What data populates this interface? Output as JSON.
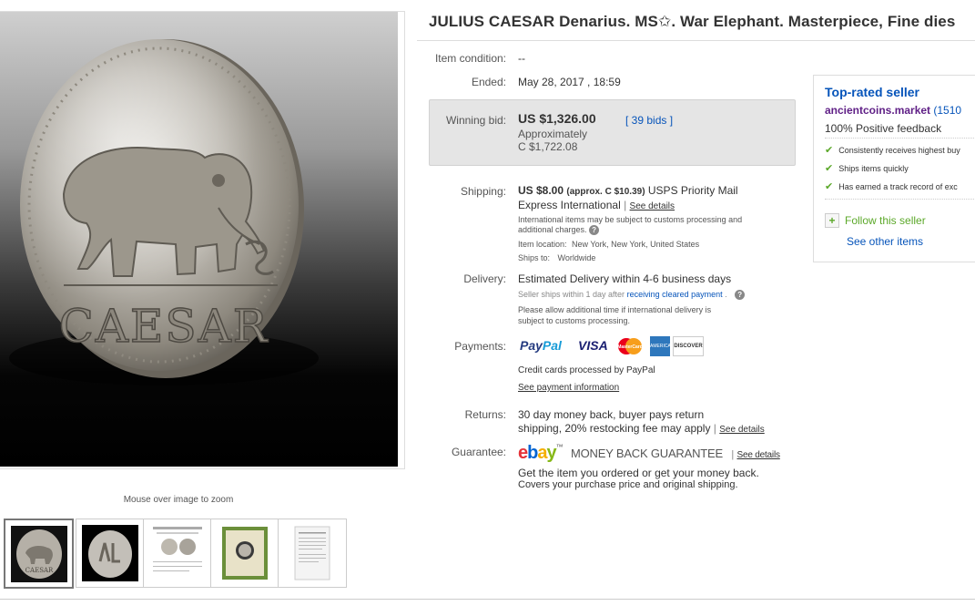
{
  "listing": {
    "title": "JULIUS CAESAR Denarius. MS✩. War Elephant. Masterpiece, Fine dies",
    "zoom_hint": "Mouse over image to zoom",
    "coin_inscription": "CAESAR"
  },
  "details": {
    "condition_label": "Item condition:",
    "condition_value": "--",
    "ended_label": "Ended:",
    "ended_value": "May 28, 2017 , 18:59",
    "bid_label": "Winning bid:",
    "bid_value": "US $1,326.00",
    "bids_link": "[ 39 bids ]",
    "approx_label": "Approximately",
    "approx_value": "C $1,722.08",
    "shipping_label": "Shipping:",
    "shipping_price": "US $8.00",
    "shipping_approx": "(approx. C $10.39)",
    "shipping_method_line1": "USPS Priority Mail",
    "shipping_method_line2": "Express International",
    "see_details": "See details",
    "customs_line1": "International items may be subject to customs processing and",
    "customs_line2": "additional charges.",
    "item_location_label": "Item location:",
    "item_location": "New York, New York, United States",
    "ships_to_label": "Ships to:",
    "ships_to": "Worldwide",
    "delivery_label": "Delivery:",
    "delivery_value": "Estimated Delivery within 4-6 business days",
    "seller_ships_pre": "Seller ships within 1 day after",
    "seller_ships_link": "receiving cleared payment",
    "seller_ships_post": ".",
    "delivery_note_line1": "Please allow additional time if international delivery is",
    "delivery_note_line2": "subject to customs processing.",
    "payments_label": "Payments:",
    "paypal_a": "Pay",
    "paypal_b": "Pal",
    "visa": "VISA",
    "mastercard": "MasterCard",
    "amex": "AMERICAN EXPRESS",
    "discover": "DISCOVER",
    "payments_note": "Credit cards processed by PayPal",
    "payment_info_link": "See payment information",
    "returns_label": "Returns:",
    "returns_line1": "30 day money back, buyer pays return",
    "returns_line2": "shipping, 20% restocking fee may apply",
    "guarantee_label": "Guarantee:",
    "ebay_e": "e",
    "ebay_b": "b",
    "ebay_a": "a",
    "ebay_y": "y",
    "ebay_tm": "™",
    "money_back": "MONEY BACK GUARANTEE",
    "guarantee_line1": "Get the item you ordered or get your money back.",
    "guarantee_line2": "Covers your purchase price and original shipping."
  },
  "seller": {
    "heading": "Top-rated seller",
    "name": "ancientcoins.market",
    "score": "(1510",
    "feedback": "100% Positive feedback",
    "perks": [
      "Consistently receives highest buy",
      "Ships items quickly",
      "Has earned a track record of exc"
    ],
    "follow": "Follow this seller",
    "other_items": "See other items"
  },
  "colors": {
    "link": "#0654ba",
    "seller_name": "#5f1f86",
    "check": "#5ba829",
    "bid_box": "#e5e5e5",
    "ebay_red": "#e53238",
    "ebay_blue": "#0064d2",
    "ebay_yellow": "#f5af02",
    "ebay_green": "#86b817"
  },
  "icons": [
    "coin-photo",
    "question-icon",
    "check-icon",
    "plus-icon",
    "paypal-logo",
    "visa-logo",
    "mastercard-logo",
    "amex-logo",
    "discover-logo",
    "ebay-logo"
  ]
}
